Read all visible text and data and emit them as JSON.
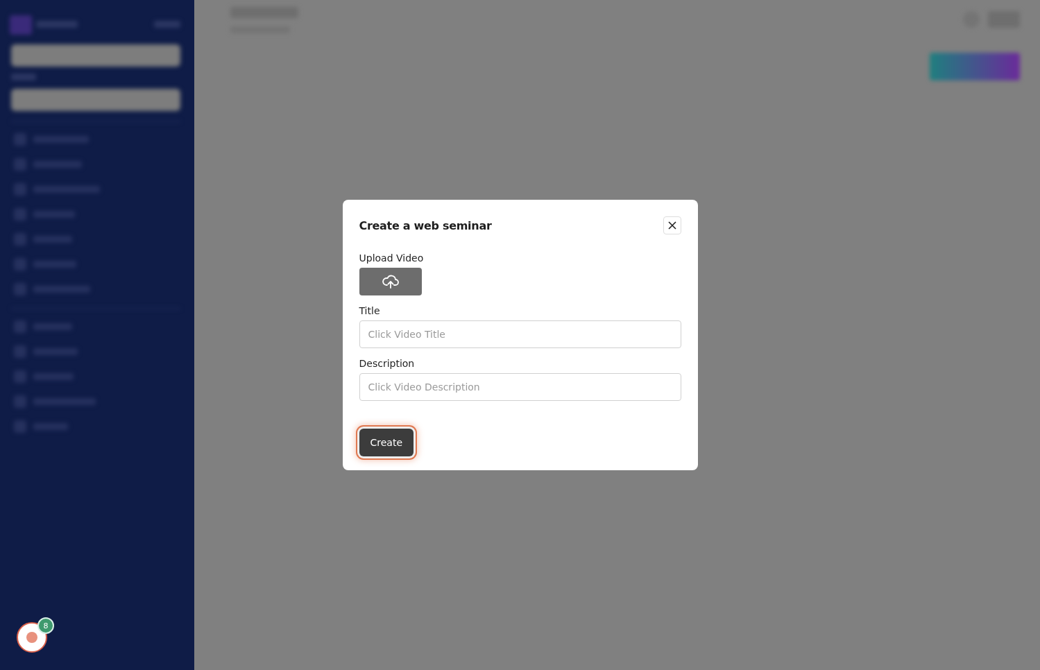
{
  "dialog": {
    "title": "Create a web seminar",
    "fields": [
      {
        "kind": "upload",
        "label": "Upload Video"
      },
      {
        "kind": "text",
        "label": "Title",
        "placeholder": "Click Video Title"
      },
      {
        "kind": "text",
        "label": "Description",
        "placeholder": "Click Video Description"
      }
    ],
    "submit": "Create"
  },
  "record_widget": {
    "badge": "8"
  }
}
